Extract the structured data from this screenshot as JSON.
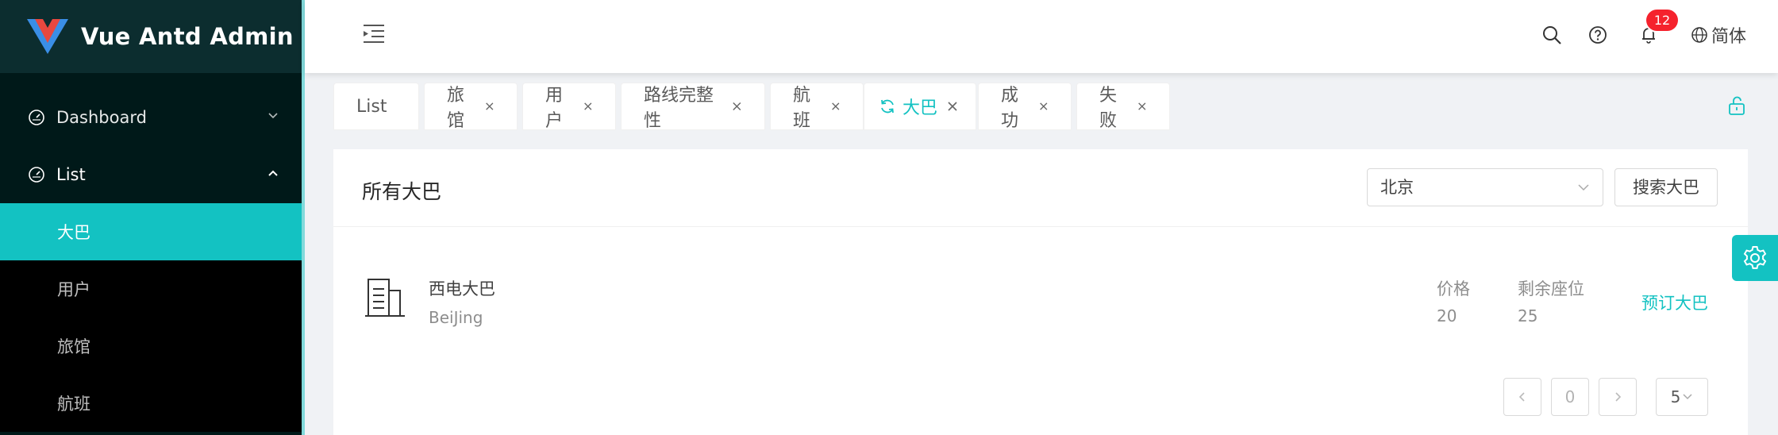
{
  "app": {
    "title": "Vue Antd Admin"
  },
  "sidebar": {
    "items": [
      {
        "label": "Dashboard",
        "icon": "dashboard-icon",
        "arrow": "chevron-down-icon"
      },
      {
        "label": "List",
        "icon": "dashboard-icon",
        "arrow": "chevron-up-icon"
      }
    ],
    "sub_items": [
      {
        "label": "大巴",
        "active": true
      },
      {
        "label": "用户",
        "active": false
      },
      {
        "label": "旅馆",
        "active": false
      },
      {
        "label": "航班",
        "active": false
      }
    ]
  },
  "header": {
    "notification_count": "12",
    "language": "简体",
    "icons": [
      "menu-fold-icon",
      "search-icon",
      "question-circle-icon",
      "bell-icon",
      "globe-icon"
    ]
  },
  "tabs": [
    {
      "label": "List",
      "active": false
    },
    {
      "label": "旅馆",
      "active": false
    },
    {
      "label": "用户",
      "active": false
    },
    {
      "label": "路线完整性",
      "active": false
    },
    {
      "label": "航班",
      "active": false
    },
    {
      "label": "大巴",
      "active": true
    },
    {
      "label": "成功",
      "active": false
    },
    {
      "label": "失败",
      "active": false
    }
  ],
  "card": {
    "title": "所有大巴",
    "select_value": "北京",
    "search_button": "搜索大巴"
  },
  "list": [
    {
      "name": "西电大巴",
      "city": "BeiJing",
      "price_label": "价格",
      "price": "20",
      "seats_label": "剩余座位",
      "seats": "25",
      "action": "预订大巴"
    }
  ],
  "pagination": {
    "current": "0",
    "page_size": "5"
  },
  "colors": {
    "primary": "#13c2c2",
    "sider_bg": "#001919",
    "badge": "#f5222d"
  }
}
